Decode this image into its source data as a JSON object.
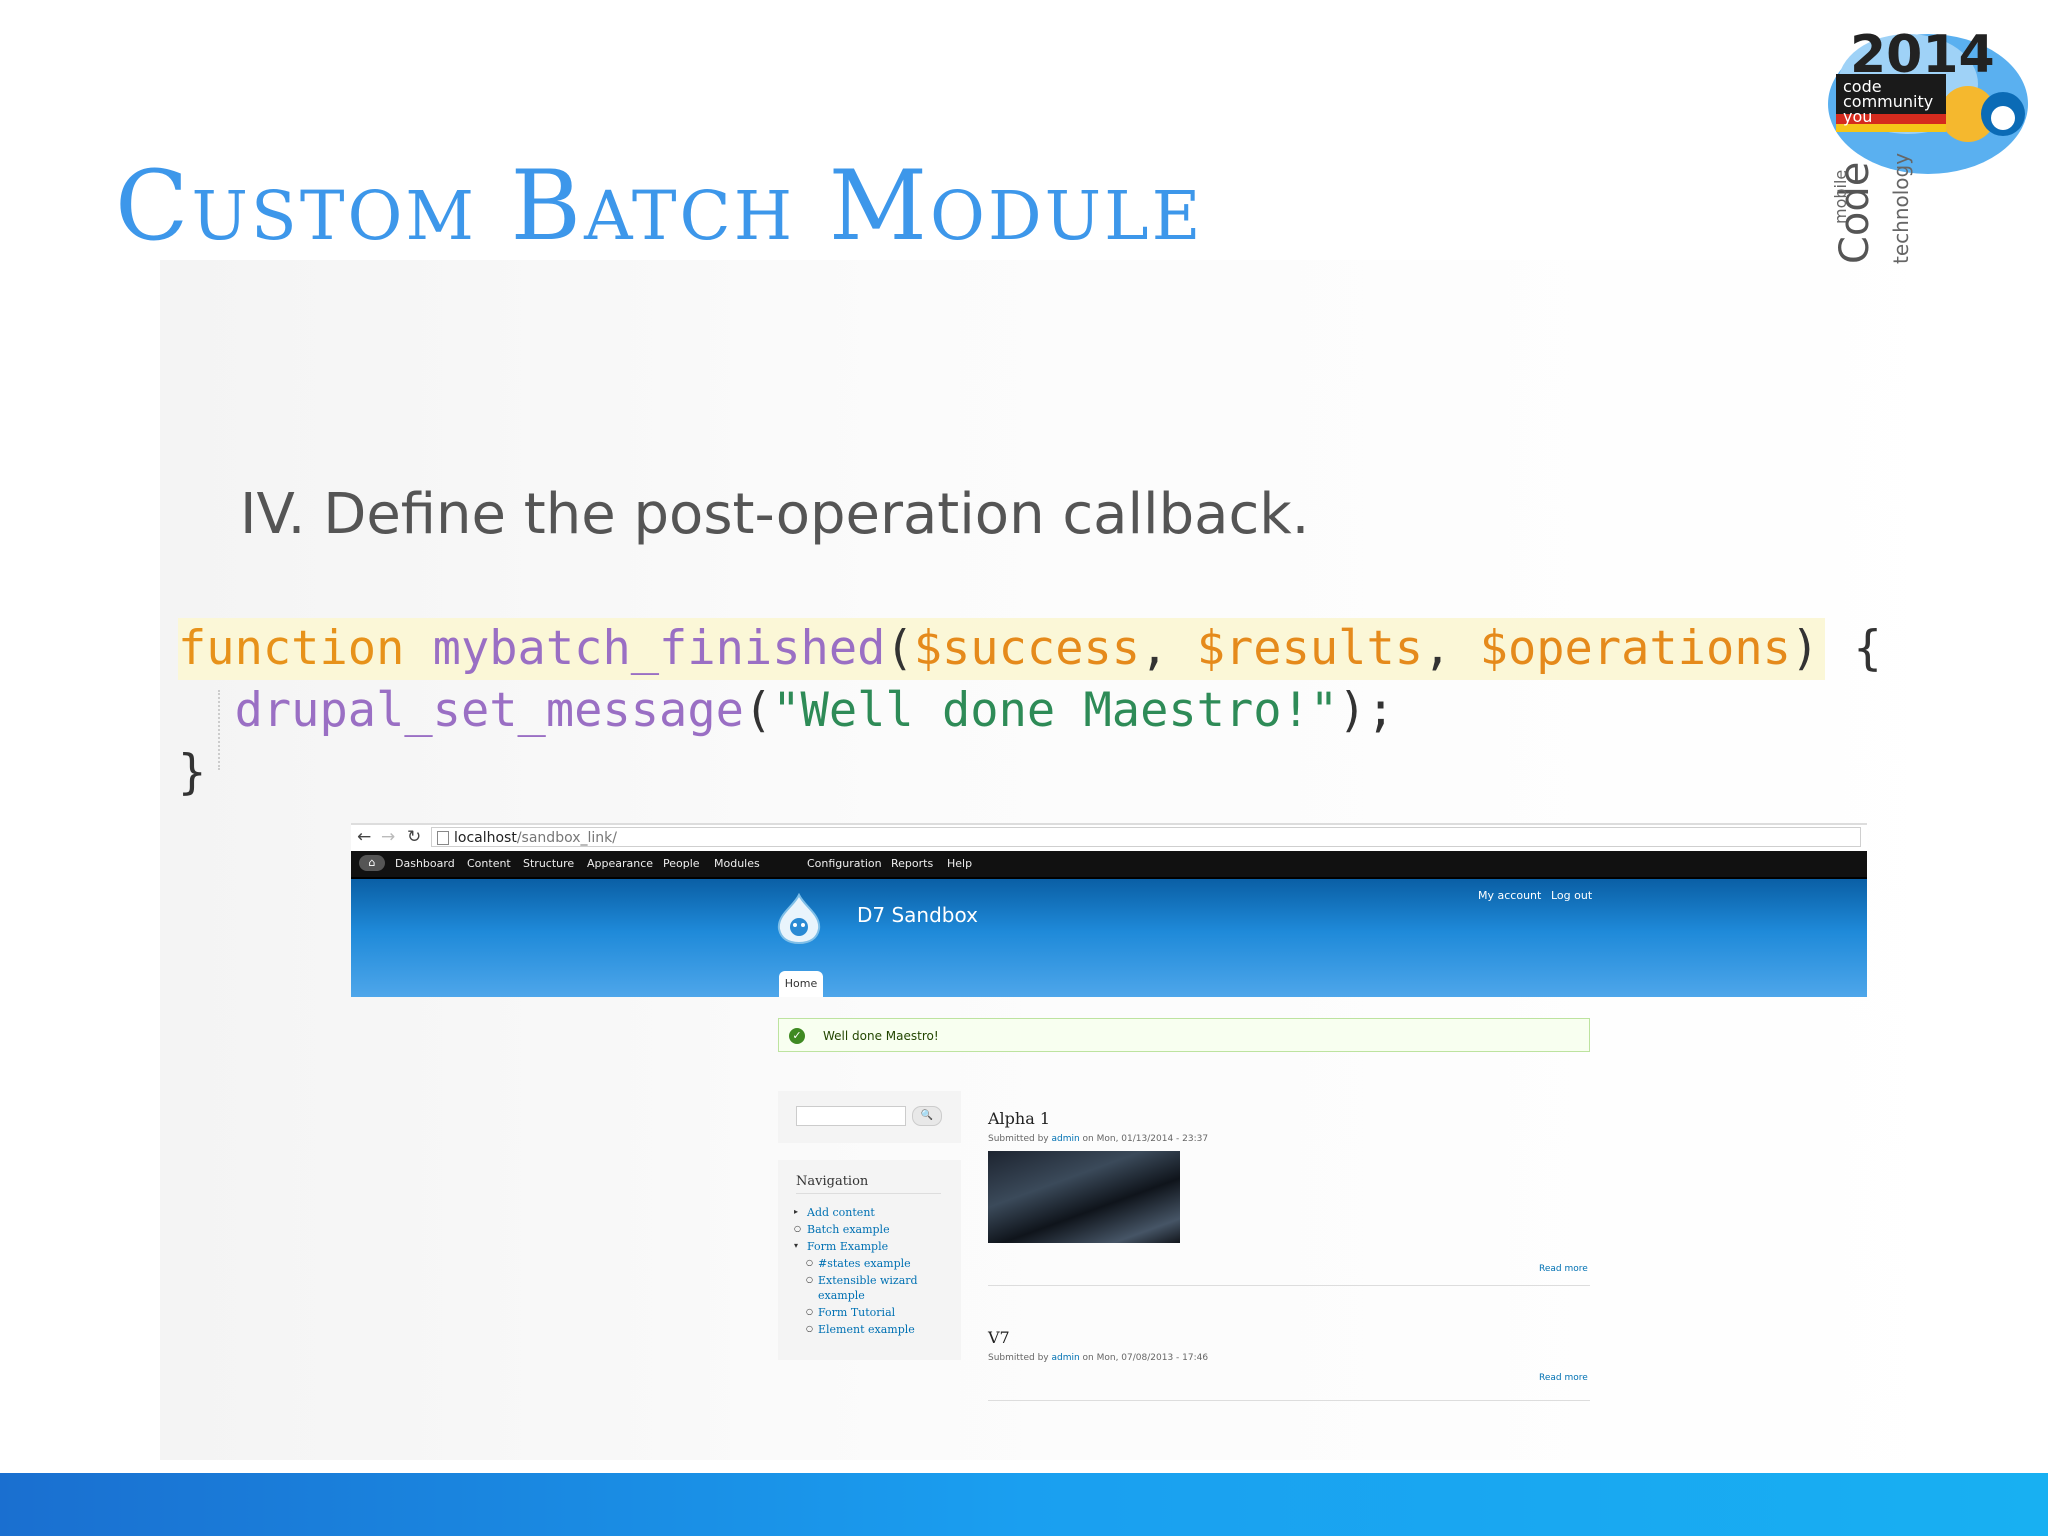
{
  "slide": {
    "title": "Custom Batch Module",
    "bullet": "IV. Define the post-operation callback.",
    "logo_text": "2014 code community you"
  },
  "code": {
    "line1": {
      "keyword": "function",
      "name": "mybatch_finished",
      "open": "(",
      "arg1": "$success",
      "sep1": ", ",
      "arg2": "$results",
      "sep2": ", ",
      "arg3": "$operations",
      "close": ")",
      "brace": " {"
    },
    "line2": {
      "call": "drupal_set_message",
      "open": "(",
      "string": "\"Well done Maestro!\"",
      "close": ");"
    },
    "line3": "}"
  },
  "browser": {
    "url_host": "localhost",
    "url_path": "/sandbox_link/",
    "toolbar": [
      "Dashboard",
      "Content",
      "Structure",
      "Appearance",
      "People",
      "Modules",
      "Configuration",
      "Reports",
      "Help"
    ],
    "site_name": "D7 Sandbox",
    "my_account": "My account",
    "log_out": "Log out",
    "home_tab": "Home",
    "status_message": "Well done Maestro!",
    "search_button": "🔍",
    "navigation": {
      "heading": "Navigation",
      "items": [
        "Add content",
        "Batch example",
        "Form Example",
        "#states example",
        "Extensible wizard",
        "example",
        "Form Tutorial",
        "Element example"
      ]
    },
    "articles": [
      {
        "title": "Alpha 1",
        "submitted_by": "Submitted by ",
        "author": "admin",
        "date": " on Mon, 01/13/2014 - 23:37",
        "read_more": "Read more"
      },
      {
        "title": "V7",
        "submitted_by": "Submitted by ",
        "author": "admin",
        "date": " on Mon, 07/08/2013 - 17:46",
        "read_more": "Read more"
      }
    ]
  },
  "colors": {
    "title": "#3d97ea",
    "keyword": "#e7921a",
    "function": "#9a6fc4",
    "string": "#2e8b57",
    "highlight": "#fbf7d7",
    "footer": "#1a9ff0"
  }
}
